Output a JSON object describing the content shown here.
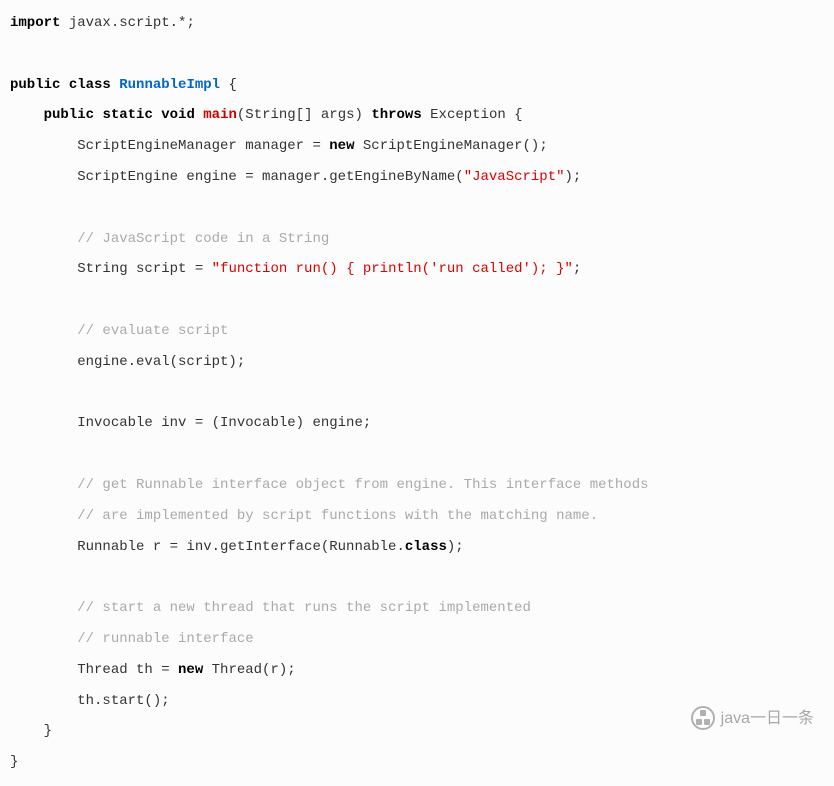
{
  "code": {
    "lines": [
      [
        {
          "c": "kw",
          "t": "import"
        },
        {
          "t": " javax.script.*;"
        }
      ],
      [],
      [
        {
          "c": "kw",
          "t": "public"
        },
        {
          "t": " "
        },
        {
          "c": "kw",
          "t": "class"
        },
        {
          "t": " "
        },
        {
          "c": "cls",
          "t": "RunnableImpl"
        },
        {
          "t": " {"
        }
      ],
      [
        {
          "t": "    "
        },
        {
          "c": "kw",
          "t": "public"
        },
        {
          "t": " "
        },
        {
          "c": "kw",
          "t": "static"
        },
        {
          "t": " "
        },
        {
          "c": "kw",
          "t": "void"
        },
        {
          "t": " "
        },
        {
          "c": "fn",
          "t": "main"
        },
        {
          "t": "(String[] args) "
        },
        {
          "c": "kw",
          "t": "throws"
        },
        {
          "t": " Exception {"
        }
      ],
      [
        {
          "t": "        ScriptEngineManager manager = "
        },
        {
          "c": "kw",
          "t": "new"
        },
        {
          "t": " ScriptEngineManager();"
        }
      ],
      [
        {
          "t": "        ScriptEngine engine = manager.getEngineByName("
        },
        {
          "c": "str",
          "t": "\"JavaScript\""
        },
        {
          "t": ");"
        }
      ],
      [],
      [
        {
          "t": "        "
        },
        {
          "c": "com",
          "t": "// JavaScript code in a String"
        }
      ],
      [
        {
          "t": "        String script = "
        },
        {
          "c": "str",
          "t": "\"function run() { println('run called'); }\""
        },
        {
          "t": ";"
        }
      ],
      [],
      [
        {
          "t": "        "
        },
        {
          "c": "com",
          "t": "// evaluate script"
        }
      ],
      [
        {
          "t": "        engine.eval(script);"
        }
      ],
      [],
      [
        {
          "t": "        Invocable inv = (Invocable) engine;"
        }
      ],
      [],
      [
        {
          "t": "        "
        },
        {
          "c": "com",
          "t": "// get Runnable interface object from engine. This interface methods"
        }
      ],
      [
        {
          "t": "        "
        },
        {
          "c": "com",
          "t": "// are implemented by script functions with the matching name."
        }
      ],
      [
        {
          "t": "        Runnable r = inv.getInterface(Runnable."
        },
        {
          "c": "kw",
          "t": "class"
        },
        {
          "t": ");"
        }
      ],
      [],
      [
        {
          "t": "        "
        },
        {
          "c": "com",
          "t": "// start a new thread that runs the script implemented"
        }
      ],
      [
        {
          "t": "        "
        },
        {
          "c": "com",
          "t": "// runnable interface"
        }
      ],
      [
        {
          "t": "        Thread th = "
        },
        {
          "c": "kw",
          "t": "new"
        },
        {
          "t": " Thread(r);"
        }
      ],
      [
        {
          "t": "        th.start();"
        }
      ],
      [
        {
          "t": "    }"
        }
      ],
      [
        {
          "t": "}"
        }
      ]
    ]
  },
  "watermark": "java一日一条"
}
